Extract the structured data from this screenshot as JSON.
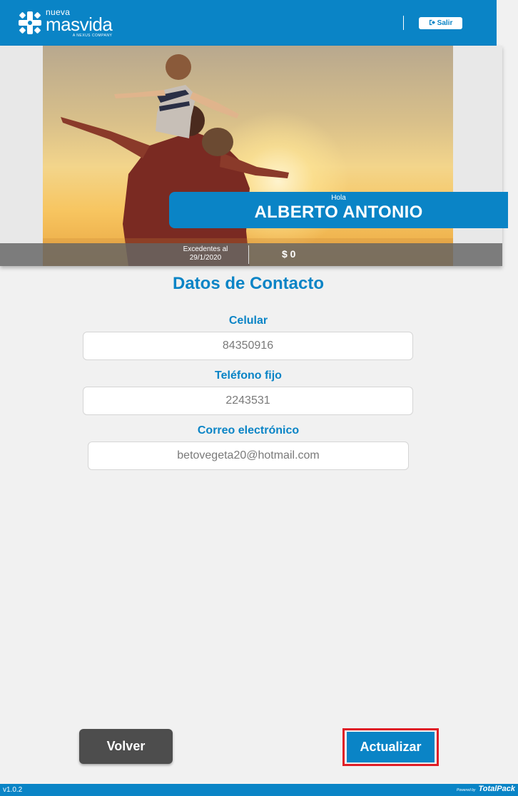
{
  "header": {
    "logo_small": "nueva",
    "logo_big": "masvida",
    "logo_tag": "A NEXUS COMPANY",
    "logout_icon": "sign-out-icon",
    "logout_label": "Salir"
  },
  "banner": {
    "greeting": "Hola",
    "name": "ALBERTO ANTONIO",
    "excedentes_label": "Excedentes al",
    "excedentes_date": "29/1/2020",
    "excedentes_value": "$ 0"
  },
  "form": {
    "title": "Datos de Contacto",
    "celular_label": "Celular",
    "celular_value": "84350916",
    "telefono_label": "Teléfono fijo",
    "telefono_value": "2243531",
    "correo_label": "Correo electrónico",
    "correo_value": "betovegeta20@hotmail.com"
  },
  "actions": {
    "volver_label": "Volver",
    "actualizar_label": "Actualizar"
  },
  "footer": {
    "version": "v1.0.2",
    "powered_by": "Powered by",
    "brand": "TotalPack"
  },
  "colors": {
    "primary": "#0a84c6",
    "highlight": "#e01e26",
    "secondary_button": "#4d4d4d"
  }
}
